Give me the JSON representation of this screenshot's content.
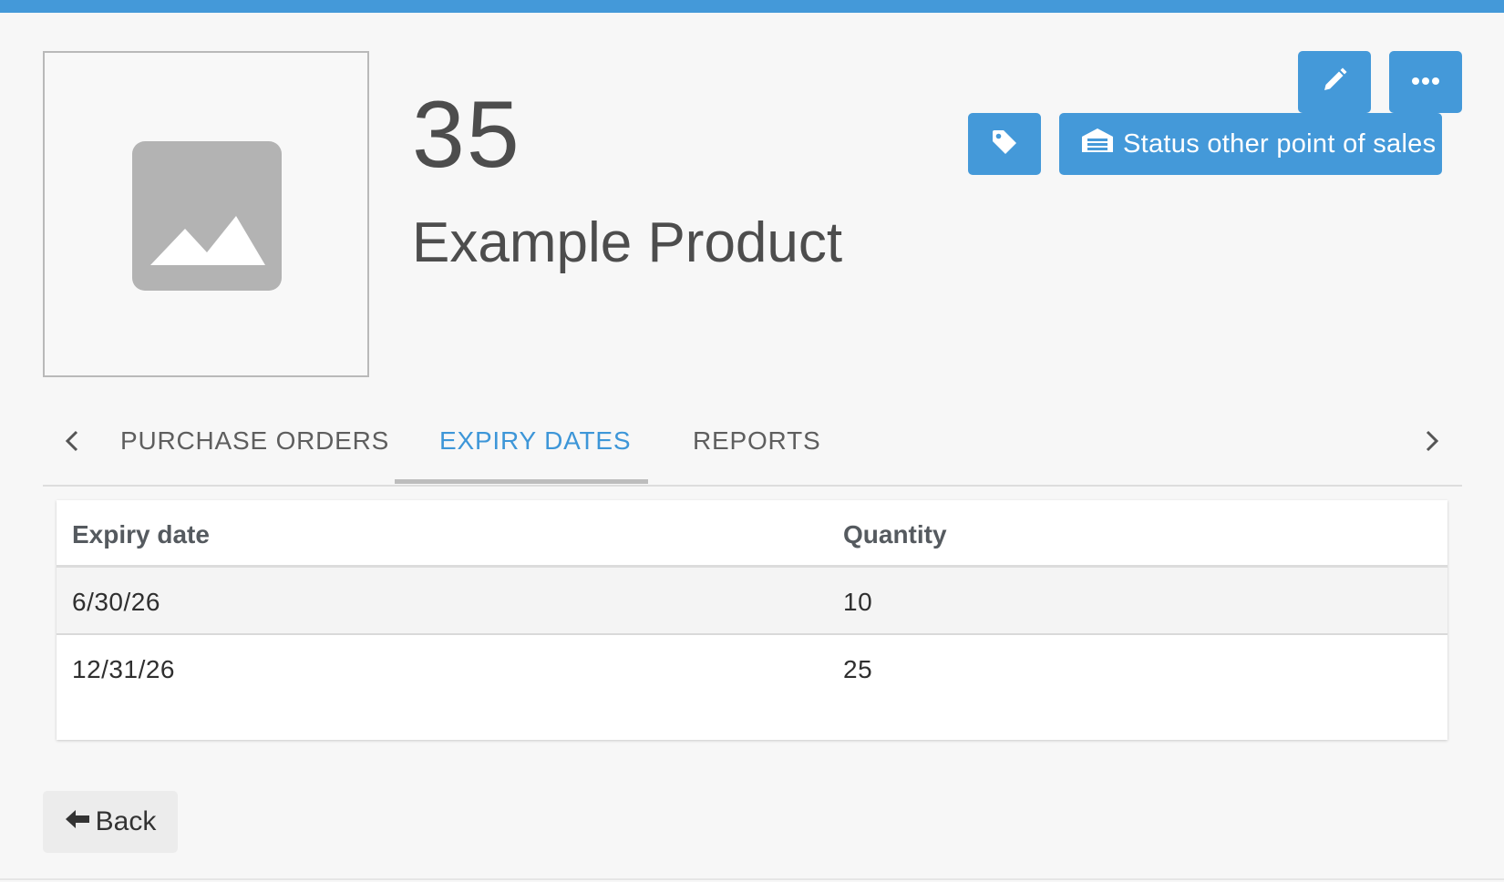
{
  "colors": {
    "accent": "#4499d9",
    "active_tab": "#3d96d8"
  },
  "product": {
    "image_icon": "image-placeholder-icon",
    "number": "35",
    "name": "Example Product"
  },
  "actions": {
    "edit_icon": "pencil-icon",
    "more_icon": "ellipsis-icon",
    "tag_icon": "tag-icon",
    "status_icon": "warehouse-icon",
    "status_label": "Status other point of sales"
  },
  "tabs": {
    "items": [
      {
        "label": "PURCHASE ORDERS"
      },
      {
        "label": "EXPIRY DATES",
        "active": true
      },
      {
        "label": "REPORTS"
      }
    ]
  },
  "table": {
    "headers": [
      "Expiry date",
      "Quantity"
    ],
    "rows": [
      [
        "6/30/26",
        "10"
      ],
      [
        "12/31/26",
        "25"
      ]
    ]
  },
  "back": {
    "label": "Back",
    "icon": "arrow-left-icon"
  }
}
